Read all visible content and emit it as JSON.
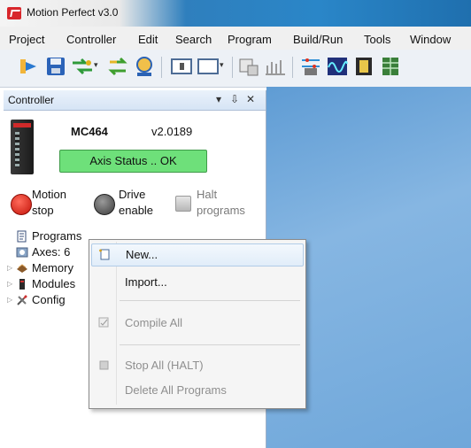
{
  "window": {
    "title": "Motion Perfect v3.0"
  },
  "menu": [
    "Project",
    "Controller",
    "Edit",
    "Search",
    "Program",
    "Build/Run",
    "Tools",
    "Window"
  ],
  "controller_panel": {
    "title": "Controller",
    "pin_symbol": "▾ ⇩ ✕",
    "controller": {
      "name": "MC464",
      "version": "v2.0189",
      "axis_status": "Axis Status .. OK"
    },
    "buttons": {
      "motion_stop": "Motion\nstop",
      "drive_enable": "Drive\nenable",
      "halt_programs": "Halt\nprograms"
    },
    "tree": [
      {
        "label": "Programs",
        "icon": "programs-icon",
        "expandable": false
      },
      {
        "label": "Axes: 6",
        "icon": "axes-icon",
        "expandable": false
      },
      {
        "label": "Memory",
        "icon": "memory-icon",
        "expandable": true
      },
      {
        "label": "Modules",
        "icon": "modules-icon",
        "expandable": true
      },
      {
        "label": "Config",
        "icon": "config-icon",
        "expandable": true
      }
    ]
  },
  "context_menu": {
    "items": [
      {
        "label": "New...",
        "enabled": true,
        "highlighted": true,
        "icon": "new-file-icon"
      },
      {
        "label": "Import...",
        "enabled": true
      },
      {
        "label": "Compile All",
        "enabled": false,
        "icon": "compile-icon"
      },
      {
        "label": "Stop All (HALT)",
        "enabled": false,
        "icon": "stop-all-icon"
      },
      {
        "label": "Delete All Programs",
        "enabled": false
      }
    ]
  },
  "colors": {
    "axis_status_ok": "#6ee07a",
    "workspace": "#6fa7da",
    "title_accent": "#2f7fbd"
  }
}
